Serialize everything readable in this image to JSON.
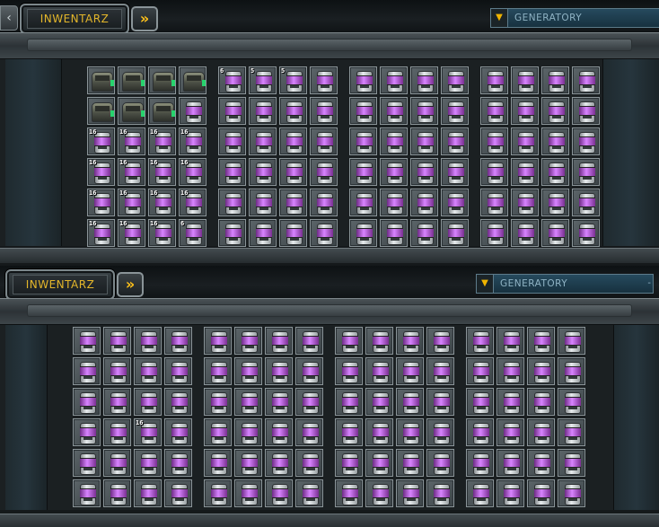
{
  "panels": [
    {
      "title": "INWENTARZ",
      "has_prev_arrow": true,
      "next_symbol": "»",
      "dropdown": {
        "icon": "triangle-down-icon",
        "label": "GENERATORY",
        "end": ""
      },
      "blocks": [
        [
          [
            "box",
            "box",
            "box",
            "box"
          ],
          [
            "box",
            "box",
            "box",
            "can"
          ],
          [
            "can:16",
            "can:16",
            "can:16",
            "can:16"
          ],
          [
            "can:16",
            "can:16",
            "can:16",
            "can:16"
          ],
          [
            "can:16",
            "can:16",
            "can:16",
            "can:16"
          ],
          [
            "can:16",
            "can:16",
            "can:16",
            "can:6"
          ]
        ],
        [
          [
            "can:6",
            "can:5",
            "can:5",
            "can"
          ],
          [
            "can",
            "can",
            "can",
            "can"
          ],
          [
            "can",
            "can",
            "can",
            "can"
          ],
          [
            "can",
            "can",
            "can",
            "can"
          ],
          [
            "can",
            "can",
            "can",
            "can"
          ],
          [
            "can",
            "can",
            "can",
            "can"
          ]
        ],
        [
          [
            "can",
            "can",
            "can",
            "can"
          ],
          [
            "can",
            "can",
            "can",
            "can"
          ],
          [
            "can",
            "can",
            "can",
            "can"
          ],
          [
            "can",
            "can",
            "can",
            "can"
          ],
          [
            "can",
            "can",
            "can",
            "can"
          ],
          [
            "can",
            "can",
            "can",
            "can"
          ]
        ],
        [
          [
            "can",
            "can",
            "can",
            "can"
          ],
          [
            "can",
            "can",
            "can",
            "can"
          ],
          [
            "can",
            "can",
            "can",
            "can"
          ],
          [
            "can",
            "can",
            "can",
            "can"
          ],
          [
            "can",
            "can",
            "can",
            "can"
          ],
          [
            "can",
            "can",
            "can",
            "can"
          ]
        ]
      ]
    },
    {
      "title": "INWENTARZ",
      "has_prev_arrow": false,
      "next_symbol": "»",
      "dropdown": {
        "icon": "triangle-down-icon",
        "label": "GENERATORY",
        "end": "-"
      },
      "blocks": [
        [
          [
            "can",
            "can",
            "can",
            "can"
          ],
          [
            "can",
            "can",
            "can",
            "can"
          ],
          [
            "can",
            "can",
            "can",
            "can"
          ],
          [
            "can",
            "can",
            "can:16",
            "can"
          ],
          [
            "can",
            "can",
            "can",
            "can"
          ],
          [
            "can",
            "can",
            "can",
            "can"
          ]
        ],
        [
          [
            "can",
            "can",
            "can",
            "can"
          ],
          [
            "can",
            "can",
            "can",
            "can"
          ],
          [
            "can",
            "can",
            "can",
            "can"
          ],
          [
            "can",
            "can",
            "can",
            "can"
          ],
          [
            "can",
            "can",
            "can",
            "can"
          ],
          [
            "can",
            "can",
            "can",
            "can"
          ]
        ],
        [
          [
            "can",
            "can",
            "can",
            "can"
          ],
          [
            "can",
            "can",
            "can",
            "can"
          ],
          [
            "can",
            "can",
            "can",
            "can"
          ],
          [
            "can",
            "can",
            "can",
            "can"
          ],
          [
            "can",
            "can",
            "can",
            "can"
          ],
          [
            "can",
            "can",
            "can",
            "can"
          ]
        ],
        [
          [
            "can",
            "can",
            "can",
            "can"
          ],
          [
            "can",
            "can",
            "can",
            "can"
          ],
          [
            "can",
            "can",
            "can",
            "can"
          ],
          [
            "can",
            "can",
            "can",
            "can"
          ],
          [
            "can",
            "can",
            "can",
            "can"
          ],
          [
            "can",
            "can",
            "can",
            "can"
          ]
        ]
      ]
    }
  ],
  "item_types": {
    "box": "armored-crate-icon",
    "can": "generator-canister-icon"
  }
}
